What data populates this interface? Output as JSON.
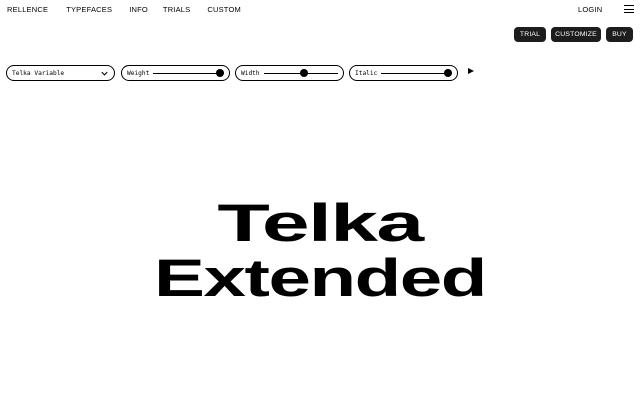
{
  "nav": {
    "brand": "RELLENCE",
    "links": [
      "TYPEFACES",
      "INFO",
      "TRIALS",
      "CUSTOM"
    ],
    "login": "LOGIN",
    "menu_icon": "hamburger-menu-icon"
  },
  "actions": {
    "trial": "TRIAL",
    "customize": "CUSTOMIZE",
    "buy": "BUY"
  },
  "controls": {
    "font_select": {
      "value": "Telka Variable",
      "icon": "chevron-down-icon"
    },
    "sliders": [
      {
        "label": "Weight",
        "value": 1.0
      },
      {
        "label": "Width",
        "value": 0.55
      },
      {
        "label": "Italic",
        "value": 1.0
      }
    ],
    "play_icon": "play-icon"
  },
  "specimen": {
    "line1": "Telka",
    "line2": "Extended"
  },
  "colors": {
    "background": "#ffffff",
    "text": "#000000",
    "button_bg": "#1d1d1d",
    "button_text": "#ffffff"
  }
}
